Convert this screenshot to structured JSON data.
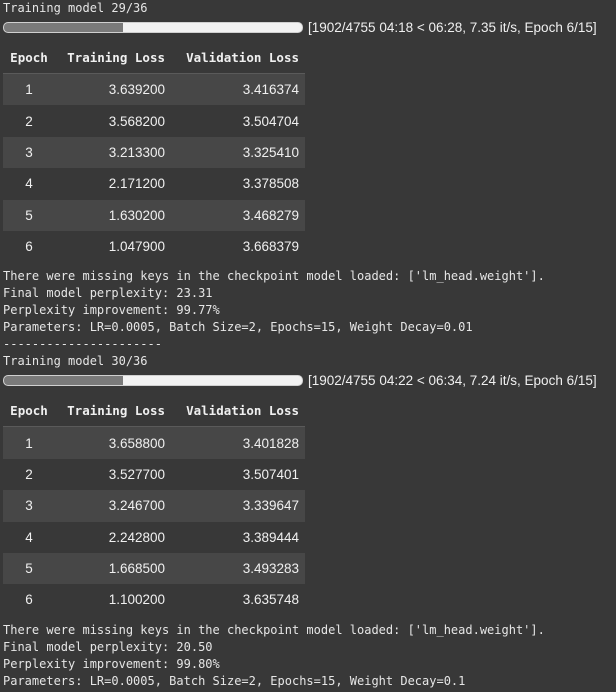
{
  "runs": [
    {
      "title": "Training model 29/36",
      "progress": {
        "fraction": 0.4,
        "text": "[1902/4755 04:18 < 06:28, 7.35 it/s, Epoch 6/15]"
      },
      "table": {
        "headers": [
          "Epoch",
          "Training Loss",
          "Validation Loss"
        ],
        "rows": [
          [
            "1",
            "3.639200",
            "3.416374"
          ],
          [
            "2",
            "3.568200",
            "3.504704"
          ],
          [
            "3",
            "3.213300",
            "3.325410"
          ],
          [
            "4",
            "2.171200",
            "3.378508"
          ],
          [
            "5",
            "1.630200",
            "3.468279"
          ],
          [
            "6",
            "1.047900",
            "3.668379"
          ]
        ]
      },
      "log_lines": [
        "There were missing keys in the checkpoint model loaded: ['lm_head.weight'].",
        "Final model perplexity: 23.31",
        "Perplexity improvement: 99.77%",
        "Parameters: LR=0.0005, Batch Size=2, Epochs=15, Weight Decay=0.01",
        "----------------------"
      ]
    },
    {
      "title": "Training model 30/36",
      "progress": {
        "fraction": 0.4,
        "text": "[1902/4755 04:22 < 06:34, 7.24 it/s, Epoch 6/15]"
      },
      "table": {
        "headers": [
          "Epoch",
          "Training Loss",
          "Validation Loss"
        ],
        "rows": [
          [
            "1",
            "3.658800",
            "3.401828"
          ],
          [
            "2",
            "3.527700",
            "3.507401"
          ],
          [
            "3",
            "3.246700",
            "3.339647"
          ],
          [
            "4",
            "2.242800",
            "3.389444"
          ],
          [
            "5",
            "1.668500",
            "3.493283"
          ],
          [
            "6",
            "1.100200",
            "3.635748"
          ]
        ]
      },
      "log_lines": [
        "There were missing keys in the checkpoint model loaded: ['lm_head.weight'].",
        "Final model perplexity: 20.50",
        "Perplexity improvement: 99.80%",
        "Parameters: LR=0.0005, Batch Size=2, Epochs=15, Weight Decay=0.1"
      ]
    }
  ],
  "colors": {
    "background": "#383838",
    "row_alt": "#474747",
    "progress_fill": "#7a7a7a",
    "progress_track": "#f2f2f2"
  }
}
